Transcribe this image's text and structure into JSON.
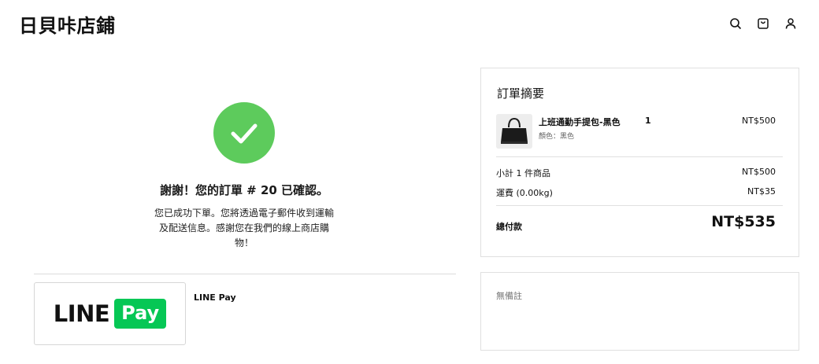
{
  "header": {
    "store_name": "日貝咔店鋪",
    "icons": [
      "search-icon",
      "shopping-bag-icon",
      "user-icon"
    ]
  },
  "confirmation": {
    "icon": "checkmark-icon",
    "heading": "謝謝！您的訂單 # 20 已確認。",
    "message": "您已成功下單。您將透過電子郵件收到運輸及配送信息。感謝您在我們的線上商店購物！"
  },
  "payment": {
    "logo_line": "LINE",
    "logo_pay": "Pay",
    "method_name": "LINE Pay"
  },
  "summary": {
    "title": "訂單摘要",
    "item": {
      "name": "上班通勤手提包-黑色",
      "quantity": "1",
      "price": "NT$500",
      "variant": "顏色：黑色"
    },
    "subtotal_label": "小計 1 件商品",
    "subtotal_value": "NT$500",
    "shipping_label": "運費 (0.00kg)",
    "shipping_value": "NT$35",
    "total_label": "總付款",
    "total_value": "NT$535"
  },
  "note": {
    "text": "無備註"
  },
  "colors": {
    "success_green": "#5dcb5c",
    "line_pay_green": "#06c755"
  }
}
